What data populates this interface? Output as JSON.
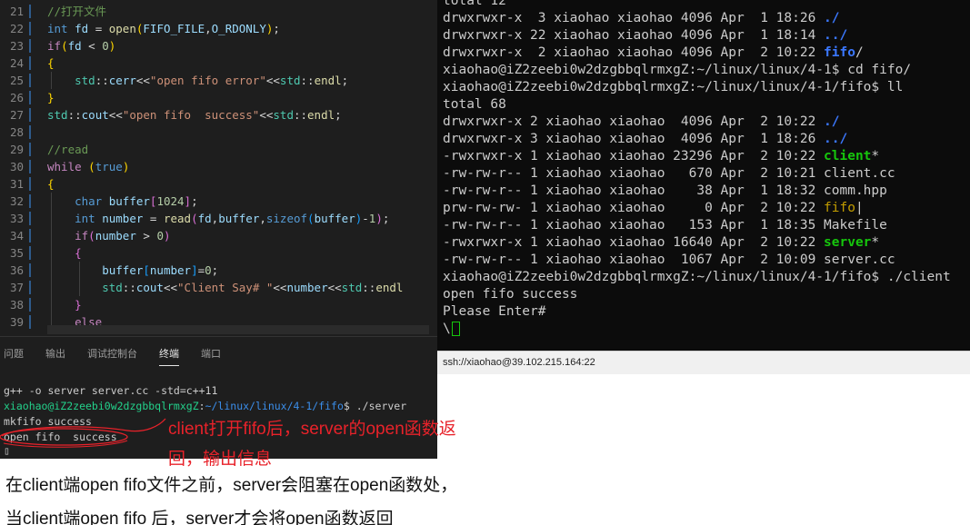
{
  "editor": {
    "lines": [
      {
        "n": "21",
        "segs": [
          [
            "cm",
            "//打开文件"
          ]
        ]
      },
      {
        "n": "22",
        "segs": [
          [
            "k1",
            "int"
          ],
          [
            "",
            " "
          ],
          [
            "vr",
            "fd"
          ],
          [
            "",
            " = "
          ],
          [
            "fn",
            "open"
          ],
          [
            "br1",
            "("
          ],
          [
            "vr",
            "FIFO_FILE"
          ],
          [
            "",
            ","
          ],
          [
            "vr",
            "O_RDONLY"
          ],
          [
            "br1",
            ")"
          ],
          [
            "",
            ";"
          ]
        ]
      },
      {
        "n": "23",
        "segs": [
          [
            "kw",
            "if"
          ],
          [
            "br1",
            "("
          ],
          [
            "vr",
            "fd"
          ],
          [
            "",
            " < "
          ],
          [
            "nm",
            "0"
          ],
          [
            "br1",
            ")"
          ]
        ]
      },
      {
        "n": "24",
        "segs": [
          [
            "br1",
            "{"
          ]
        ]
      },
      {
        "n": "25",
        "segs": [
          [
            "",
            "    "
          ],
          [
            "ty",
            "std"
          ],
          [
            "",
            "::"
          ],
          [
            "vr",
            "cerr"
          ],
          [
            "",
            "<<"
          ],
          [
            "st",
            "\"open fifo error\""
          ],
          [
            "",
            "<<"
          ],
          [
            "ty",
            "std"
          ],
          [
            "",
            "::"
          ],
          [
            "fn",
            "endl"
          ],
          [
            "",
            ";"
          ]
        ]
      },
      {
        "n": "26",
        "segs": [
          [
            "br1",
            "}"
          ]
        ]
      },
      {
        "n": "27",
        "segs": [
          [
            "ty",
            "std"
          ],
          [
            "",
            "::"
          ],
          [
            "vr",
            "cout"
          ],
          [
            "",
            "<<"
          ],
          [
            "st",
            "\"open fifo  success\""
          ],
          [
            "",
            "<<"
          ],
          [
            "ty",
            "std"
          ],
          [
            "",
            "::"
          ],
          [
            "fn",
            "endl"
          ],
          [
            "",
            ";"
          ]
        ]
      },
      {
        "n": "28",
        "segs": []
      },
      {
        "n": "29",
        "segs": [
          [
            "cm",
            "//read"
          ]
        ]
      },
      {
        "n": "30",
        "segs": [
          [
            "kw",
            "while"
          ],
          [
            "",
            " "
          ],
          [
            "br1",
            "("
          ],
          [
            "k1",
            "true"
          ],
          [
            "br1",
            ")"
          ]
        ]
      },
      {
        "n": "31",
        "segs": [
          [
            "br1",
            "{"
          ]
        ]
      },
      {
        "n": "32",
        "segs": [
          [
            "",
            "    "
          ],
          [
            "k1",
            "char"
          ],
          [
            "",
            " "
          ],
          [
            "vr",
            "buffer"
          ],
          [
            "br2",
            "["
          ],
          [
            "nm",
            "1024"
          ],
          [
            "br2",
            "]"
          ],
          [
            "",
            ";"
          ]
        ]
      },
      {
        "n": "33",
        "segs": [
          [
            "",
            "    "
          ],
          [
            "k1",
            "int"
          ],
          [
            "",
            " "
          ],
          [
            "vr",
            "number"
          ],
          [
            "",
            " = "
          ],
          [
            "fn",
            "read"
          ],
          [
            "br2",
            "("
          ],
          [
            "vr",
            "fd"
          ],
          [
            "",
            ","
          ],
          [
            "vr",
            "buffer"
          ],
          [
            "",
            ","
          ],
          [
            "k1",
            "sizeof"
          ],
          [
            "br3",
            "("
          ],
          [
            "vr",
            "buffer"
          ],
          [
            "br3",
            ")"
          ],
          [
            "",
            "-"
          ],
          [
            "nm",
            "1"
          ],
          [
            "br2",
            ")"
          ],
          [
            "",
            ";"
          ]
        ]
      },
      {
        "n": "34",
        "segs": [
          [
            "",
            "    "
          ],
          [
            "kw",
            "if"
          ],
          [
            "br2",
            "("
          ],
          [
            "vr",
            "number"
          ],
          [
            "",
            " > "
          ],
          [
            "nm",
            "0"
          ],
          [
            "br2",
            ")"
          ]
        ]
      },
      {
        "n": "35",
        "segs": [
          [
            "",
            "    "
          ],
          [
            "br2",
            "{"
          ]
        ]
      },
      {
        "n": "36",
        "segs": [
          [
            "",
            "        "
          ],
          [
            "vr",
            "buffer"
          ],
          [
            "br3",
            "["
          ],
          [
            "vr",
            "number"
          ],
          [
            "br3",
            "]"
          ],
          [
            "",
            "="
          ],
          [
            "nm",
            "0"
          ],
          [
            "",
            ";"
          ]
        ]
      },
      {
        "n": "37",
        "segs": [
          [
            "",
            "        "
          ],
          [
            "ty",
            "std"
          ],
          [
            "",
            "::"
          ],
          [
            "vr",
            "cout"
          ],
          [
            "",
            "<<"
          ],
          [
            "st",
            "\"Client Say# \""
          ],
          [
            "",
            "<<"
          ],
          [
            "vr",
            "number"
          ],
          [
            "",
            "<<"
          ],
          [
            "ty",
            "std"
          ],
          [
            "",
            "::"
          ],
          [
            "fn",
            "endl"
          ]
        ]
      },
      {
        "n": "38",
        "segs": [
          [
            "",
            "    "
          ],
          [
            "br2",
            "}"
          ]
        ]
      },
      {
        "n": "39",
        "segs": [
          [
            "",
            "    "
          ],
          [
            "kw",
            "else"
          ]
        ]
      }
    ]
  },
  "panel": {
    "tabs": [
      "问题",
      "输出",
      "调试控制台",
      "终端",
      "端口"
    ],
    "active_tab": "终端",
    "terminal": {
      "compile_cmd": "g++ -o server server.cc -std=c++11",
      "prompt_user": "xiaohao@iZ2zeebi0w2dzgbbqlrmxgZ",
      "prompt_path": "~/linux/linux/4-1/fifo",
      "prompt_cmd": "$ ./server",
      "out1": "mkfifo success",
      "out2": "open fifo  success"
    }
  },
  "ssh": {
    "lines": [
      [
        [
          "",
          "total 12"
        ]
      ],
      [
        [
          "",
          "drwxrwxr-x  3 xiaohao xiaohao 4096 Apr  1 18:26 "
        ],
        [
          "dirc",
          "./"
        ]
      ],
      [
        [
          "",
          "drwxrwxr-x 22 xiaohao xiaohao 4096 Apr  1 18:14 "
        ],
        [
          "dirc",
          "../"
        ]
      ],
      [
        [
          "",
          "drwxrwxr-x  2 xiaohao xiaohao 4096 Apr  2 10:22 "
        ],
        [
          "dirc",
          "fifo"
        ],
        [
          "",
          "/"
        ]
      ],
      [
        [
          "",
          "xiaohao@iZ2zeebi0w2dzgbbqlrmxgZ:~/linux/linux/4-1$ cd fifo/"
        ]
      ],
      [
        [
          "",
          "xiaohao@iZ2zeebi0w2dzgbbqlrmxgZ:~/linux/linux/4-1/fifo$ ll"
        ]
      ],
      [
        [
          "",
          "total 68"
        ]
      ],
      [
        [
          "",
          "drwxrwxr-x 2 xiaohao xiaohao  4096 Apr  2 10:22 "
        ],
        [
          "dirc",
          "./"
        ]
      ],
      [
        [
          "",
          "drwxrwxr-x 3 xiaohao xiaohao  4096 Apr  1 18:26 "
        ],
        [
          "dirc",
          "../"
        ]
      ],
      [
        [
          "",
          "-rwxrwxr-x 1 xiaohao xiaohao 23296 Apr  2 10:22 "
        ],
        [
          "exec",
          "client"
        ],
        [
          "",
          "*"
        ]
      ],
      [
        [
          "",
          "-rw-rw-r-- 1 xiaohao xiaohao   670 Apr  2 10:21 client.cc"
        ]
      ],
      [
        [
          "",
          "-rw-rw-r-- 1 xiaohao xiaohao    38 Apr  1 18:32 comm.hpp"
        ]
      ],
      [
        [
          "",
          "prw-rw-rw- 1 xiaohao xiaohao     0 Apr  2 10:22 "
        ],
        [
          "pipe",
          "fifo"
        ],
        [
          "",
          "|"
        ]
      ],
      [
        [
          "",
          "-rw-rw-r-- 1 xiaohao xiaohao   153 Apr  1 18:35 Makefile"
        ]
      ],
      [
        [
          "",
          "-rwxrwxr-x 1 xiaohao xiaohao 16640 Apr  2 10:22 "
        ],
        [
          "exec",
          "server"
        ],
        [
          "",
          "*"
        ]
      ],
      [
        [
          "",
          "-rw-rw-r-- 1 xiaohao xiaohao  1067 Apr  2 10:09 server.cc"
        ]
      ],
      [
        [
          "",
          "xiaohao@iZ2zeebi0w2dzgbbqlrmxgZ:~/linux/linux/4-1/fifo$ ./client"
        ]
      ],
      [
        [
          "",
          "open fifo success"
        ]
      ],
      [
        [
          "",
          "Please Enter#"
        ]
      ],
      [
        [
          "",
          "\\"
        ]
      ]
    ],
    "status": "ssh://xiaohao@39.102.215.164:22"
  },
  "annotation": {
    "line1": "client打开fifo后，server的open函数返",
    "line2": "回，输出信息"
  },
  "notes": {
    "line1": "在client端open fifo文件之前，server会阻塞在open函数处，",
    "line2": "当client端open fifo 后，server才会将open函数返回"
  },
  "colors": {
    "annotation": "#e8222a",
    "editor_bg": "#1e1e1e",
    "terminal_bg": "#0c0c0c"
  }
}
